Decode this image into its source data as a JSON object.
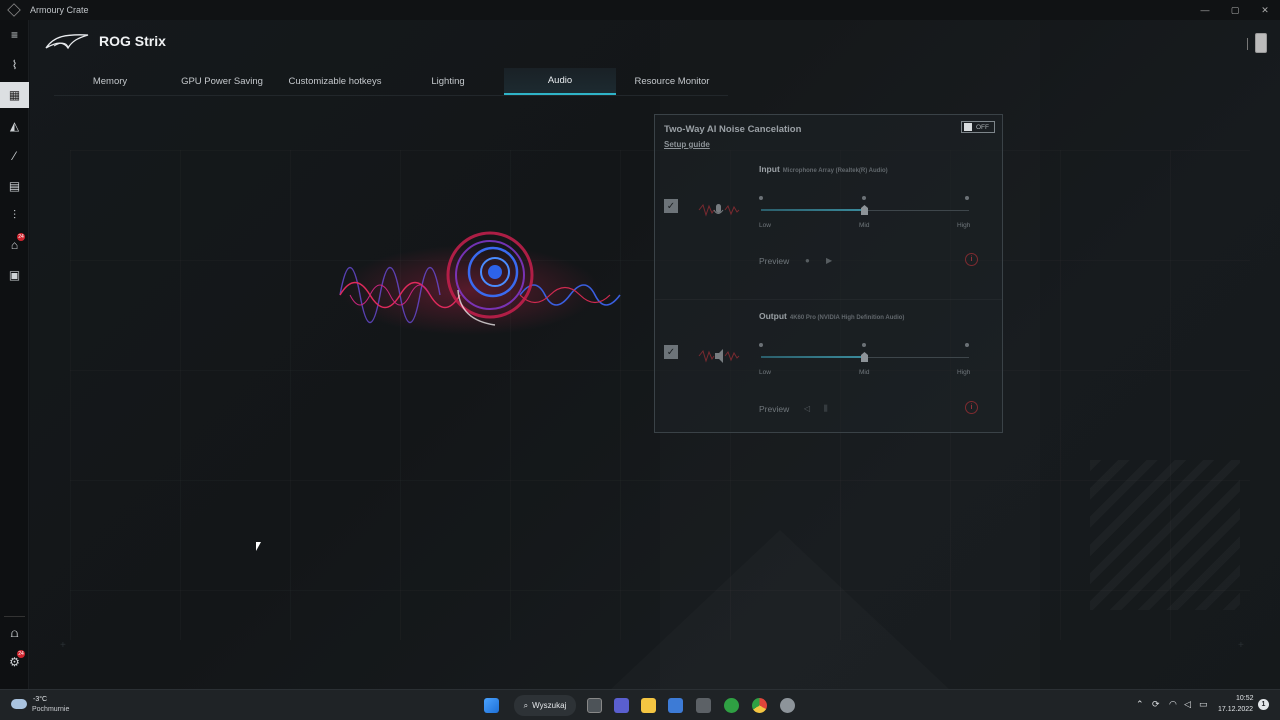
{
  "window": {
    "title": "Armoury Crate",
    "minimize": "—",
    "maximize": "▢",
    "close": "✕"
  },
  "header": {
    "app_name": "ROG Strix"
  },
  "sidebar": {
    "items": [
      {
        "icon": "hamburger-menu-icon",
        "glyph": "≡"
      },
      {
        "icon": "rog-home-icon",
        "glyph": "⌇"
      },
      {
        "icon": "keyboard-device-icon",
        "glyph": "▦",
        "active": true
      },
      {
        "icon": "aura-sync-icon",
        "glyph": "◭"
      },
      {
        "icon": "armoury-slash-icon",
        "glyph": "⁄"
      },
      {
        "icon": "game-library-icon",
        "glyph": "▤"
      },
      {
        "icon": "scenario-profiles-icon",
        "glyph": "⫶"
      },
      {
        "icon": "deals-tag-icon",
        "glyph": "⌂",
        "badge": "24"
      },
      {
        "icon": "news-icon",
        "glyph": "▣"
      },
      {
        "icon": "user-center-icon",
        "glyph": "⩍"
      },
      {
        "icon": "settings-gear-icon",
        "glyph": "⚙",
        "badge": "24"
      }
    ]
  },
  "tabs": [
    {
      "label": "Memory",
      "active": false
    },
    {
      "label": "GPU Power Saving",
      "active": false
    },
    {
      "label": "Customizable hotkeys",
      "active": false
    },
    {
      "label": "Lighting",
      "active": false
    },
    {
      "label": "Audio",
      "active": true
    },
    {
      "label": "Resource Monitor",
      "active": false
    }
  ],
  "panel": {
    "title": "Two-Way AI Noise Cancelation",
    "setup_link": "Setup guide",
    "toggle_label": "OFF",
    "input": {
      "label": "Input",
      "device": "Microphone Array (Realtek(R) Audio)",
      "levels": [
        "Low",
        "Mid",
        "High"
      ],
      "value": "Mid",
      "preview_label": "Preview",
      "info": "i"
    },
    "output": {
      "label": "Output",
      "device": "4K60 Pro (NVIDIA High Definition Audio)",
      "levels": [
        "Low",
        "Mid",
        "High"
      ],
      "value": "Mid",
      "preview_label": "Preview",
      "info": "i"
    }
  },
  "taskbar": {
    "weather_temp": "-3°C",
    "weather_desc": "Pochmurnie",
    "search_label": "Wyszukaj",
    "time": "10:52",
    "date": "17.12.2022",
    "notification_count": "1",
    "colors": {
      "start": "#3a8ee6",
      "files": "#f4c542",
      "xbox": "#2fa043",
      "chrome_red": "#e0443a"
    }
  }
}
